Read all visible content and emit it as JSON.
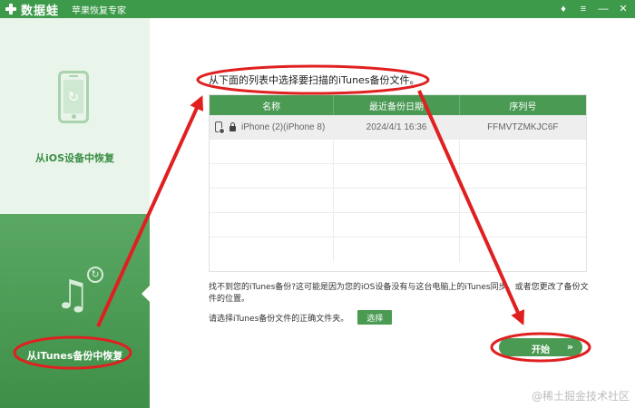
{
  "window": {
    "app_name": "数据蛙",
    "app_subtitle": "苹果恢复专家",
    "controls": {
      "gem": "♦",
      "menu": "≡",
      "minimize": "—",
      "close": "✕"
    }
  },
  "sidebar": {
    "items": [
      {
        "label": "从iOS设备中恢复",
        "icon": "phone-refresh-icon",
        "active": false
      },
      {
        "label": "从iTunes备份中恢复",
        "icon": "music-note-icon",
        "active": true
      }
    ]
  },
  "main": {
    "instruction": "从下面的列表中选择要扫描的iTunes备份文件。",
    "table": {
      "columns": [
        "名称",
        "最近备份日期",
        "序列号"
      ],
      "rows": [
        {
          "name": "iPhone (2)(iPhone 8)",
          "date": "2024/4/1 16:36",
          "serial": "FFMVTZMKJC6F",
          "locked": true,
          "selected": true
        }
      ]
    },
    "hint": "找不到您的iTunes备份?这可能是因为您的iOS设备没有与这台电脑上的iTunes同步，或者您更改了备份文件的位置。",
    "choose_text": "请选择iTunes备份文件的正确文件夹。",
    "choose_button": "选择",
    "start_button": "开始",
    "start_arrow": "»"
  },
  "watermark": "@稀土掘金技术社区",
  "colors": {
    "brand": "#3d9a4a",
    "annotation": "#e02020"
  }
}
